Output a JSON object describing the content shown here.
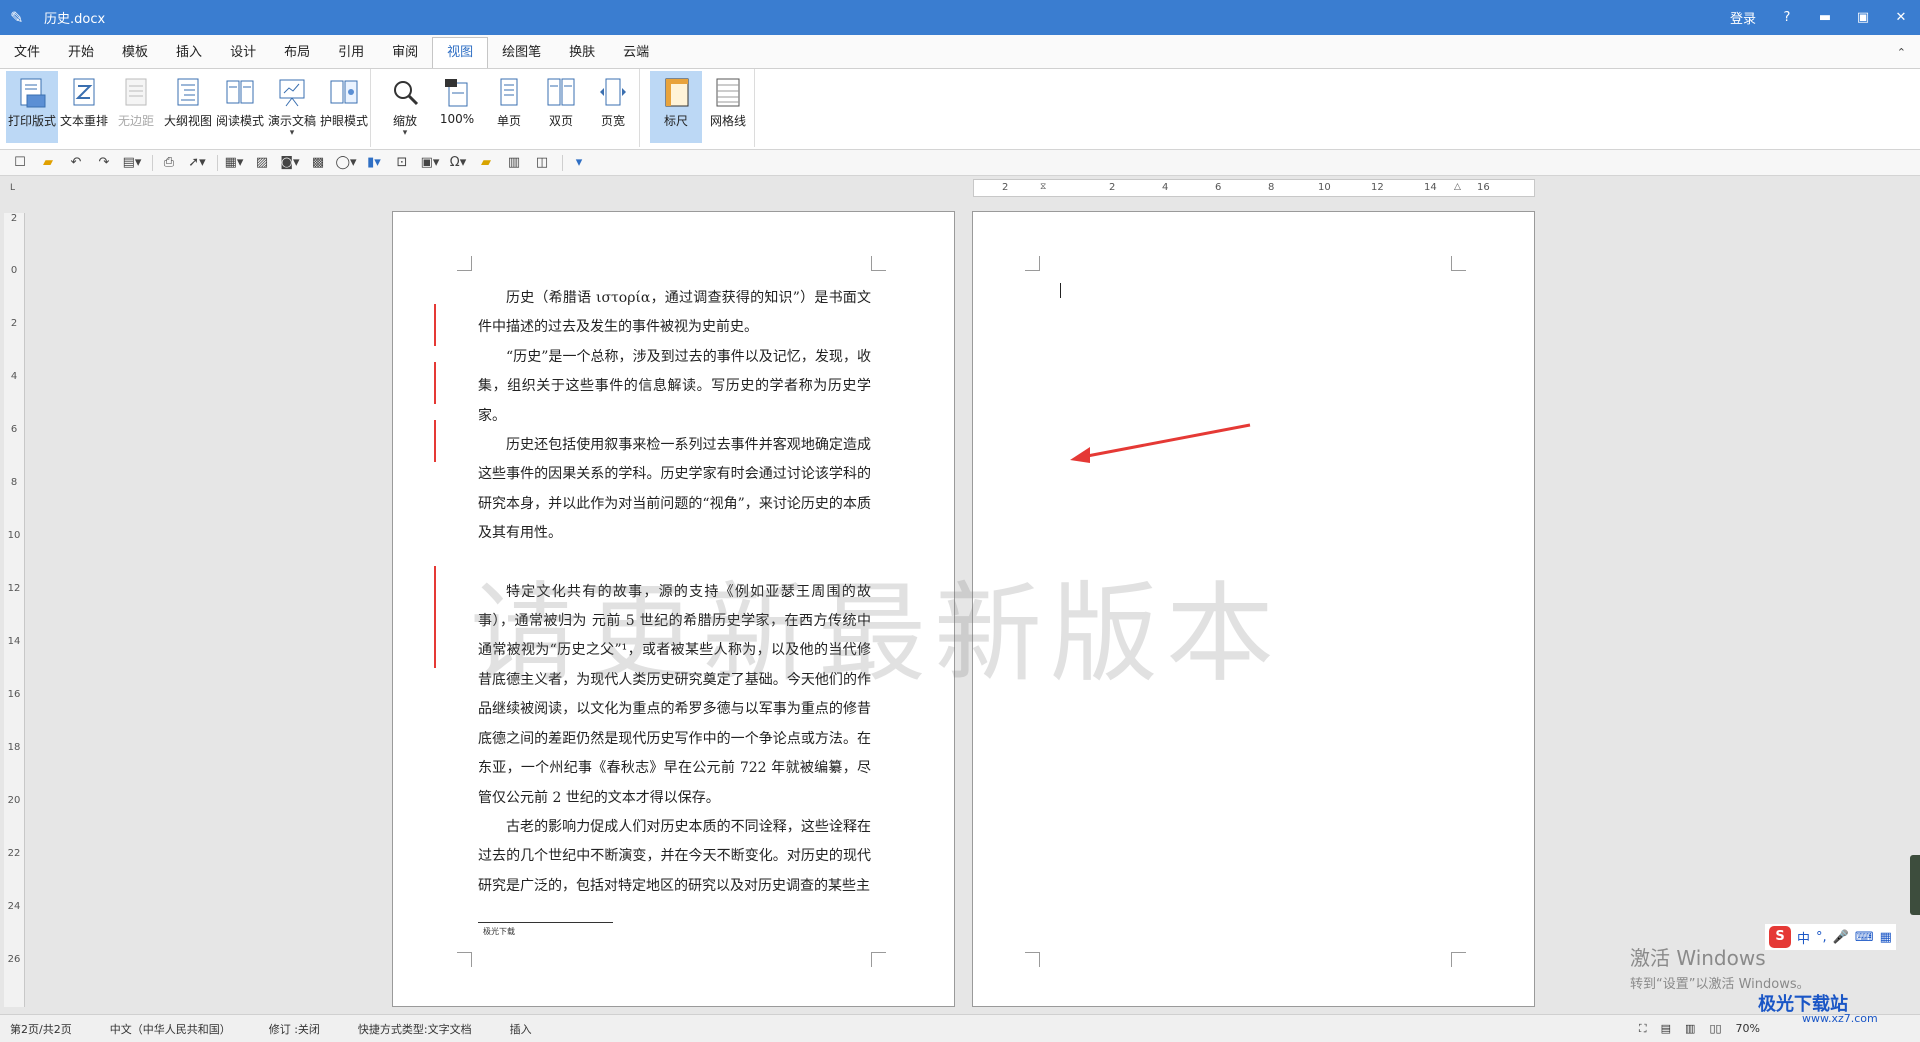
{
  "window": {
    "title": "历史.docx",
    "login_label": "登录",
    "help_label": "?",
    "min_label": "▬",
    "max_label": "▣",
    "close_label": "✕"
  },
  "menu": {
    "tabs": [
      {
        "label": "文件"
      },
      {
        "label": "开始"
      },
      {
        "label": "模板"
      },
      {
        "label": "插入"
      },
      {
        "label": "设计"
      },
      {
        "label": "布局"
      },
      {
        "label": "引用"
      },
      {
        "label": "审阅"
      },
      {
        "label": "视图",
        "active": true
      },
      {
        "label": "绘图笔"
      },
      {
        "label": "换肤"
      },
      {
        "label": "云端"
      }
    ],
    "collapse_glyph": "⌃"
  },
  "ribbon": {
    "print_layout": "打印版式",
    "text_reflow": "文本重排",
    "no_margin": "无边距",
    "outline_view": "大纲视图",
    "reading_mode": "阅读模式",
    "presentation": "演示文稿",
    "eye_care": "护眼模式",
    "zoom": "缩放",
    "zoom_100": "100%",
    "single_page": "单页",
    "double_page": "双页",
    "page_width": "页宽",
    "ruler": "标尺",
    "gridlines": "网格线"
  },
  "ruler": {
    "horizontal_ticks": [
      "2",
      "2",
      "4",
      "6",
      "8",
      "10",
      "12",
      "14",
      "16"
    ],
    "vertical_ticks": [
      "2",
      "0",
      "2",
      "4",
      "6",
      "8",
      "10",
      "12",
      "14",
      "16",
      "18",
      "20",
      "22",
      "24",
      "26"
    ],
    "corner_glyph": "L"
  },
  "document": {
    "paragraphs": [
      "历史（希腊语 ιστορία，通过调查获得的知识”）是书面文件中描述的过去及发生的事件被视为史前史。",
      "“历史”是一个总称，涉及到过去的事件以及记忆，发现，收集，组织关于这些事件的信息解读。写历史的学者称为历史学家。",
      "历史还包括使用叙事来检一系列过去事件并客观地确定造成这些事件的因果关系的学科。历史学家有时会通过讨论该学科的研究本身，并以此作为对当前问题的“视角”，来讨论历史的本质及其有用性。",
      "特定文化共有的故事，源的支持《例如亚瑟王周围的故事），通常被归为 元前 5 世纪的希腊历史学家，在西方传统中通常被视为“历史之父”¹，或者被某些人称为，以及他的当代修昔底德主义者，为现代人类历史研究奠定了基础。今天他们的作品继续被阅读，以文化为重点的希罗多德与以军事为重点的修昔底德之间的差距仍然是现代历史写作中的一个争论点或方法。在东亚，一个州纪事《春秋志》早在公元前 722 年就被编纂，尽管仅公元前 2 世纪的文本才得以保存。",
      "古老的影响力促成人们对历史本质的不同诠释，这些诠释在过去的几个世纪中不断演变，并在今天不断变化。对历史的现代研究是广泛的，包括对特定地区的研究以及对历史调查的某些主"
    ],
    "footnote": "极光下载",
    "watermark": "请更新最新版本"
  },
  "status": {
    "page": "第2页/共2页",
    "language": "中文（中华人民共和国）",
    "revision": "修订 :关闭",
    "shortcut": "快捷方式类型:文字文档",
    "insert_mode": "插入",
    "zoom": "70%"
  },
  "overlay": {
    "activation_title": "激活 Windows",
    "activation_sub": "转到“设置”以激活 Windows。",
    "ime_mode": "中",
    "site_logo": "极光下载站",
    "site_url": "www.xz7.com"
  }
}
